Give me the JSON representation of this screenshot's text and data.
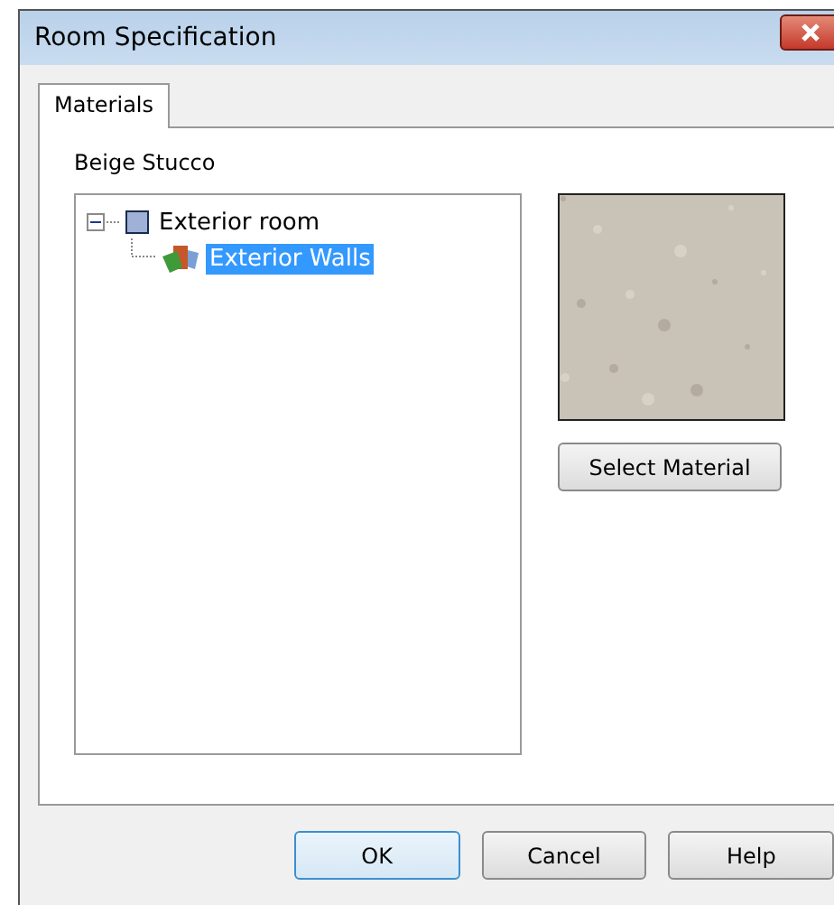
{
  "window": {
    "title": "Room Specification"
  },
  "tabs": [
    {
      "label": "Materials",
      "selected": true
    }
  ],
  "material_name": "Beige Stucco",
  "tree": [
    {
      "label": "Exterior room",
      "kind": "room",
      "expanded": true,
      "selected": false,
      "children": [
        {
          "label": "Exterior Walls",
          "kind": "wall",
          "selected": true
        }
      ]
    }
  ],
  "select_button": "Select Material",
  "buttons": [
    {
      "label": "OK",
      "default": true
    },
    {
      "label": "Cancel",
      "default": false
    },
    {
      "label": "Help",
      "default": false
    }
  ]
}
